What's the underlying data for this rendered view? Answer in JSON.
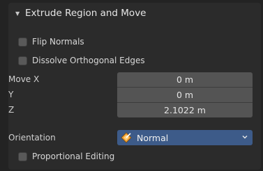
{
  "panel": {
    "title": "Extrude Region and Move"
  },
  "checkboxes": [
    {
      "label": "Flip Normals",
      "checked": false
    },
    {
      "label": "Dissolve Orthogonal Edges",
      "checked": false
    }
  ],
  "move": [
    {
      "label": "Move X",
      "value": "0 m"
    },
    {
      "label": "Y",
      "value": "0 m"
    },
    {
      "label": "Z",
      "value": "2.1022 m"
    }
  ],
  "orientation": {
    "label": "Orientation",
    "value": "Normal",
    "icon": "orientation-normal-icon"
  },
  "proportional": {
    "label": "Proportional Editing",
    "checked": false
  },
  "colors": {
    "panel_bg": "#2b2b2b",
    "field_bg": "#545454",
    "dropdown_bg": "#3d5b89",
    "icon_orange": "#f0a030"
  }
}
